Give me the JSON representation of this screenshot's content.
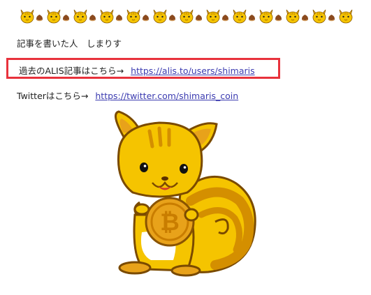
{
  "post": {
    "author_line": "記事を書いた人　しまりす",
    "alis_label": "過去のALIS記事はこちら→",
    "alis_link": "https://alis.to/users/shimaris",
    "twitter_label": "Twitterはこちら→",
    "twitter_link": "https://twitter.com/shimaris_coin"
  },
  "colors": {
    "highlight_border": "#e8323c",
    "link": "#3b3bb0",
    "squirrel_body": "#f5c400",
    "squirrel_dark": "#d48f00",
    "coin": "#e8a21a"
  },
  "icons": [
    "squirrel-face-icon",
    "chestnut-icon",
    "squirrel-holding-bitcoin-illustration",
    "bitcoin-coin-icon"
  ]
}
